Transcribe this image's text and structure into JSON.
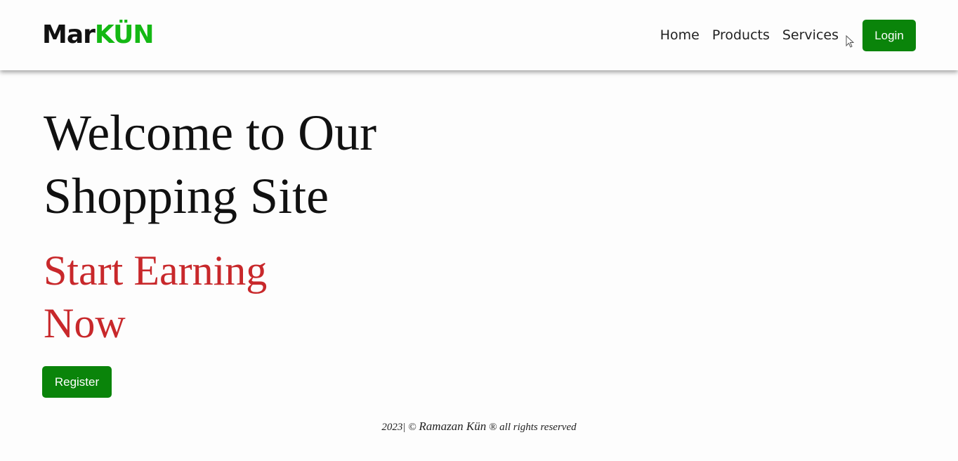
{
  "header": {
    "logo_main": "Mar",
    "logo_accent": "KÜN",
    "nav": {
      "home": "Home",
      "products": "Products",
      "services": "Services"
    },
    "login_label": "Login"
  },
  "hero": {
    "title_line1": "Welcome to Our",
    "title_line2": "Shopping Site",
    "subtitle_line1": "Start Earning",
    "subtitle_line2": "Now",
    "register_label": "Register"
  },
  "footer": {
    "prefix": "2023| © ",
    "name": "Ramazan Kün",
    "suffix": " ® all rights reserved"
  },
  "colors": {
    "brand_green": "#0a840a",
    "logo_accent": "#14b814",
    "subtitle_red": "#c8282b"
  },
  "icons": {
    "cursor": "mouse-pointer-icon"
  }
}
